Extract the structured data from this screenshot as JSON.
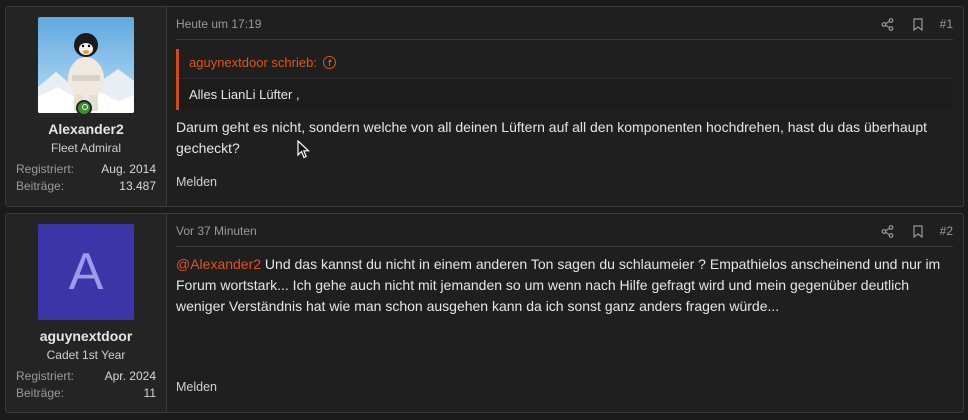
{
  "posts": [
    {
      "user": {
        "name": "Alexander2",
        "title": "Fleet Admiral",
        "registered_label": "Registriert:",
        "registered_value": "Aug. 2014",
        "posts_label": "Beiträge:",
        "posts_value": "13.487",
        "online": true
      },
      "time": "Heute um 17:19",
      "number": "#1",
      "quote": {
        "author": "aguynextdoor schrieb:",
        "text": "Alles LianLi Lüfter ,"
      },
      "text": "Darum geht es nicht, sondern welche von all deinen Lüftern auf all den komponenten hochdrehen, hast du das überhaupt gecheckt?",
      "report_label": "Melden"
    },
    {
      "user": {
        "name": "aguynextdoor",
        "avatar_letter": "A",
        "title": "Cadet 1st Year",
        "registered_label": "Registriert:",
        "registered_value": "Apr. 2024",
        "posts_label": "Beiträge:",
        "posts_value": "11"
      },
      "time": "Vor 37 Minuten",
      "number": "#2",
      "mention": "@Alexander2",
      "text": " Und das kannst du nicht in einem anderen Ton sagen du schlaumeier ? Empathielos anscheinend und nur im Forum wortstark... Ich gehe auch nicht mit jemanden so um wenn nach Hilfe gefragt wird und mein gegenüber deutlich weniger Verständnis hat wie man schon ausgehen kann da ich sonst ganz anders fragen würde...",
      "report_label": "Melden"
    }
  ],
  "icons": [
    "share-icon",
    "bookmark-icon",
    "arrow-up-circle-icon",
    "cursor-icon"
  ],
  "colors": {
    "accent": "#e0541f",
    "avatar_bg": "#3b35a8",
    "online": "#3d8f2f"
  }
}
